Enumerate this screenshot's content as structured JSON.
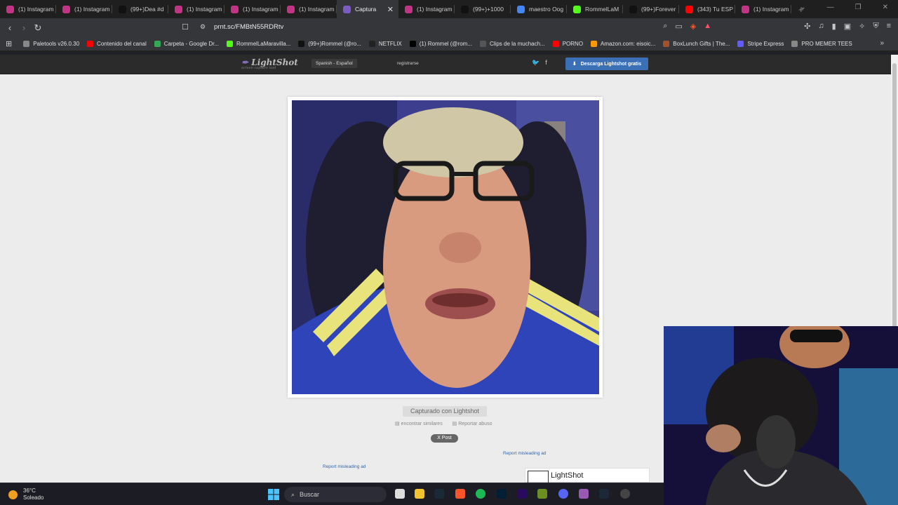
{
  "tabs": [
    {
      "label": "(1) Instagram",
      "color": "#c13584"
    },
    {
      "label": "(1) Instagram",
      "color": "#c13584"
    },
    {
      "label": "(99+)Dea #d",
      "color": "#111111"
    },
    {
      "label": "(1) Instagram",
      "color": "#c13584"
    },
    {
      "label": "(1) Instagram",
      "color": "#c13584"
    },
    {
      "label": "(1) Instagram",
      "color": "#c13584"
    },
    {
      "label": "Captura",
      "color": "#7b5cc2",
      "active": true
    },
    {
      "label": "(1) Instagram",
      "color": "#c13584"
    },
    {
      "label": "(99+)+1000",
      "color": "#111111"
    },
    {
      "label": "maestro Oog",
      "color": "#4285f4"
    },
    {
      "label": "RommelLaM",
      "color": "#53fc18"
    },
    {
      "label": "(99+)Forever",
      "color": "#111111"
    },
    {
      "label": "(343) Tu ESP",
      "color": "#ff0000"
    },
    {
      "label": "(1) Instagram",
      "color": "#c13584"
    }
  ],
  "address": {
    "url": "prnt.sc/FMBtN55RDRtv"
  },
  "bookmarks": [
    {
      "label": "Paletools v26.0.30",
      "color": "#888888"
    },
    {
      "label": "Contenido del canal",
      "color": "#ff0000"
    },
    {
      "label": "Carpeta - Google Dr...",
      "color": "#34a853"
    },
    {
      "label": "RommelLaMaravilla...",
      "color": "#53fc18"
    },
    {
      "label": "(99+)Rommel (@ro...",
      "color": "#111111"
    },
    {
      "label": "NETFLIX",
      "color": "#222222"
    },
    {
      "label": "(1) Rommel (@rom...",
      "color": "#000000"
    },
    {
      "label": "Clips de la muchach...",
      "color": "#555555"
    },
    {
      "label": "PORNO",
      "color": "#ff0000"
    },
    {
      "label": "Amazon.com: eisoic...",
      "color": "#ff9900"
    },
    {
      "label": "BoxLunch Gifts | The...",
      "color": "#a0522d"
    },
    {
      "label": "Stripe Express",
      "color": "#635bff"
    },
    {
      "label": "PRO MEMER TEES",
      "color": "#888888"
    }
  ],
  "lightshot": {
    "logo": "LightShot",
    "logo_sub": "screen capture tool",
    "language": "Spanish - Español",
    "register": "registrarse",
    "download": "Descarga Lightshot gratis",
    "captured": "Capturado con Lightshot",
    "find_similar": "encontrar similares",
    "report_abuse": "Reportar abuso",
    "post": "X Post",
    "report_ad_1": "Report misleading ad",
    "report_ad_2": "Report misleading ad",
    "ad_title": "LightShot"
  },
  "taskbar": {
    "temp": "36°C",
    "weather": "Soleado",
    "search": "Buscar"
  }
}
